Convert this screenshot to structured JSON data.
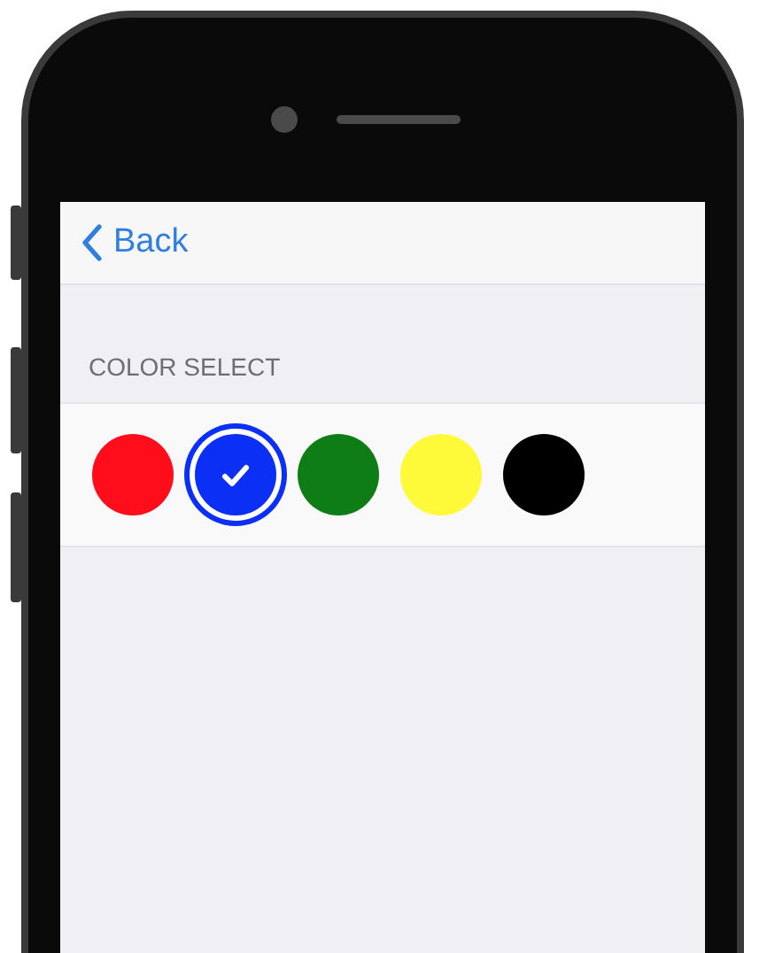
{
  "navigation": {
    "back_label": "Back"
  },
  "section": {
    "header": "COLOR SELECT",
    "colors": [
      {
        "color": "#ff0d1b",
        "selected": false
      },
      {
        "color": "#0b2ff5",
        "selected": true
      },
      {
        "color": "#0f7d16",
        "selected": false
      },
      {
        "color": "#fefa3a",
        "selected": false
      },
      {
        "color": "#000000",
        "selected": false
      }
    ]
  }
}
